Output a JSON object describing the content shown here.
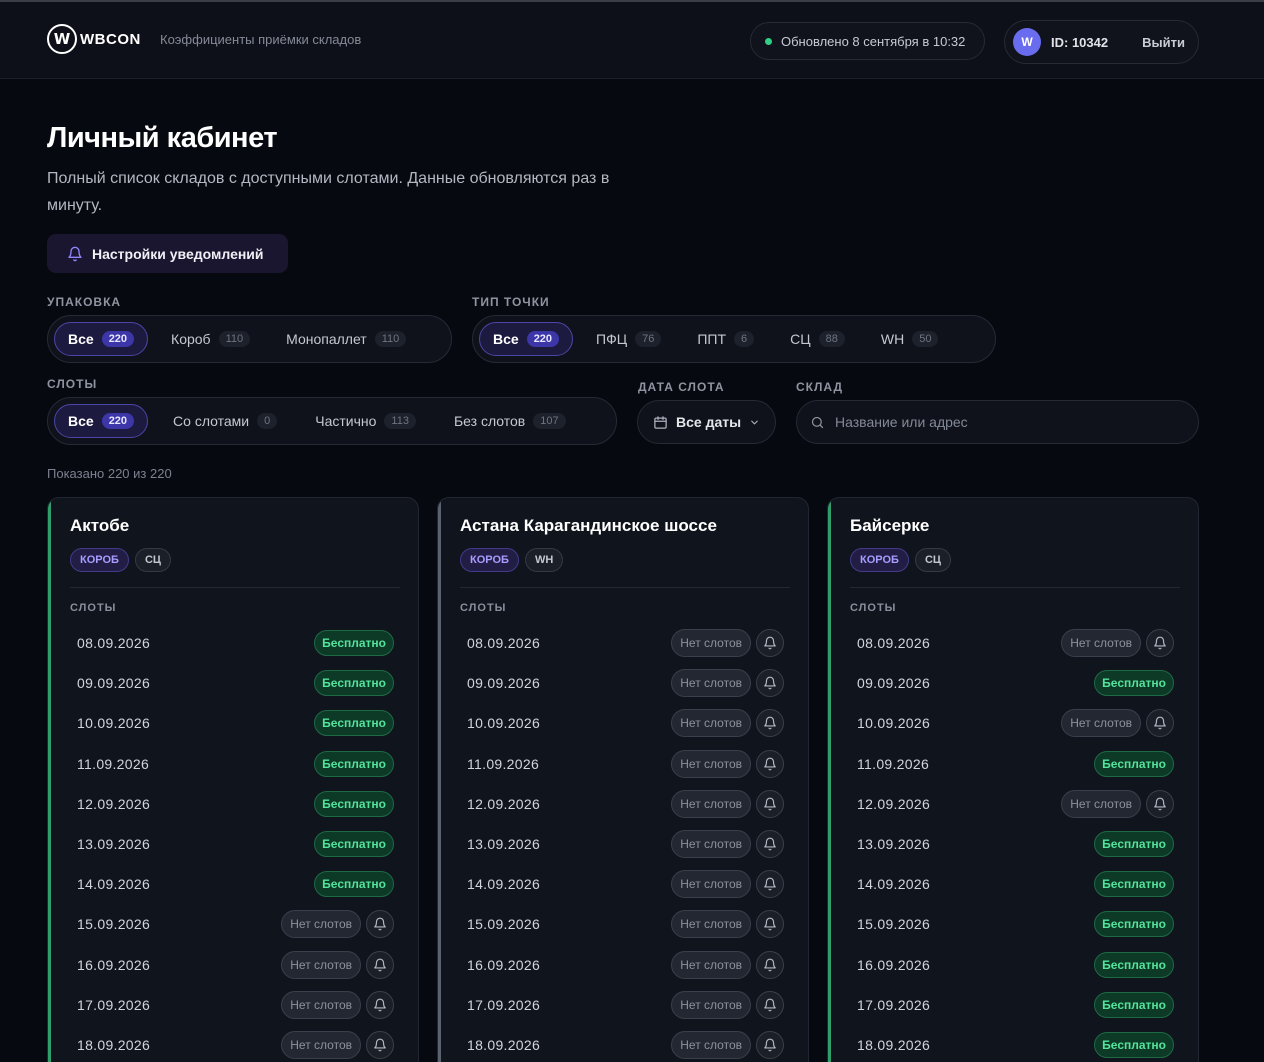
{
  "header": {
    "logo_mark": "W",
    "logo_text": "WBCON",
    "subtitle": "Коэффициенты приёмки складов",
    "status": "Обновлено 8 сентября в 10:32",
    "avatar_letter": "W",
    "user_id": "ID: 10342",
    "logout": "Выйти"
  },
  "page": {
    "title": "Личный кабинет",
    "lead": "Полный список складов с доступными слотами. Данные обновляются раз в минуту.",
    "notify_button": "Настройки уведомлений",
    "shown": "Показано 220 из 220"
  },
  "filters": {
    "packaging": {
      "label": "Упаковка",
      "items": [
        {
          "label": "Все",
          "count": "220"
        },
        {
          "label": "Короб",
          "count": "110"
        },
        {
          "label": "Монопаллет",
          "count": "110"
        }
      ]
    },
    "point_type": {
      "label": "Тип точки",
      "items": [
        {
          "label": "Все",
          "count": "220"
        },
        {
          "label": "ПФЦ",
          "count": "76"
        },
        {
          "label": "ППТ",
          "count": "6"
        },
        {
          "label": "СЦ",
          "count": "88"
        },
        {
          "label": "WH",
          "count": "50"
        }
      ]
    },
    "slots": {
      "label": "Слоты",
      "items": [
        {
          "label": "Все",
          "count": "220"
        },
        {
          "label": "Со слотами",
          "count": "0"
        },
        {
          "label": "Частично",
          "count": "113"
        },
        {
          "label": "Без слотов",
          "count": "107"
        }
      ]
    },
    "date": {
      "label": "Дата слота",
      "value": "Все даты"
    },
    "warehouse": {
      "label": "Склад",
      "placeholder": "Название или адрес"
    }
  },
  "labels": {
    "free": "Бесплатно",
    "none": "Нет слотов",
    "slots": "СЛОТЫ"
  },
  "colors": {
    "free_accent": "#2f9e6a",
    "none_accent": "#5a6270",
    "brand": "#4b46a6"
  },
  "cards": [
    {
      "name": "Актобе",
      "tags": [
        "КОРОБ",
        "СЦ"
      ],
      "accent": "free",
      "slots": [
        {
          "date": "08.09.2026",
          "free": true
        },
        {
          "date": "09.09.2026",
          "free": true
        },
        {
          "date": "10.09.2026",
          "free": true
        },
        {
          "date": "11.09.2026",
          "free": true
        },
        {
          "date": "12.09.2026",
          "free": true
        },
        {
          "date": "13.09.2026",
          "free": true
        },
        {
          "date": "14.09.2026",
          "free": true
        },
        {
          "date": "15.09.2026",
          "free": false
        },
        {
          "date": "16.09.2026",
          "free": false
        },
        {
          "date": "17.09.2026",
          "free": false
        },
        {
          "date": "18.09.2026",
          "free": false
        }
      ]
    },
    {
      "name": "Астана Карагандинское шоссе",
      "tags": [
        "КОРОБ",
        "WH"
      ],
      "accent": "none",
      "slots": [
        {
          "date": "08.09.2026",
          "free": false
        },
        {
          "date": "09.09.2026",
          "free": false
        },
        {
          "date": "10.09.2026",
          "free": false
        },
        {
          "date": "11.09.2026",
          "free": false
        },
        {
          "date": "12.09.2026",
          "free": false
        },
        {
          "date": "13.09.2026",
          "free": false
        },
        {
          "date": "14.09.2026",
          "free": false
        },
        {
          "date": "15.09.2026",
          "free": false
        },
        {
          "date": "16.09.2026",
          "free": false
        },
        {
          "date": "17.09.2026",
          "free": false
        },
        {
          "date": "18.09.2026",
          "free": false
        }
      ]
    },
    {
      "name": "Байсерке",
      "tags": [
        "КОРОБ",
        "СЦ"
      ],
      "accent": "free",
      "slots": [
        {
          "date": "08.09.2026",
          "free": false
        },
        {
          "date": "09.09.2026",
          "free": true
        },
        {
          "date": "10.09.2026",
          "free": false
        },
        {
          "date": "11.09.2026",
          "free": true
        },
        {
          "date": "12.09.2026",
          "free": false
        },
        {
          "date": "13.09.2026",
          "free": true
        },
        {
          "date": "14.09.2026",
          "free": true
        },
        {
          "date": "15.09.2026",
          "free": true
        },
        {
          "date": "16.09.2026",
          "free": true
        },
        {
          "date": "17.09.2026",
          "free": true
        },
        {
          "date": "18.09.2026",
          "free": true
        }
      ]
    }
  ]
}
